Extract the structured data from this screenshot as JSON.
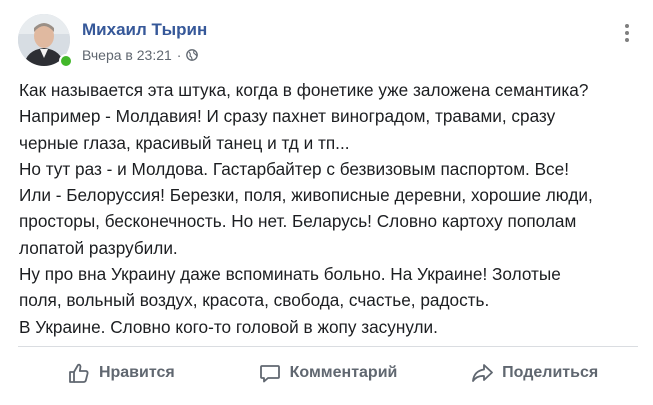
{
  "post": {
    "author": "Михаил Тырин",
    "timestamp": "Вчера в 23:21",
    "separator": "·",
    "privacy_icon": "globe-icon",
    "lines": [
      "Как называется эта штука, когда в фонетике уже заложена семантика?",
      "Например - Молдавия! И сразу пахнет виноградом, травами, сразу",
      "черные глаза, красивый танец и тд и тп...",
      "Но тут раз - и Молдова. Гастарбайтер с безвизовым паспортом. Все!",
      "Или - Белоруссия! Березки, поля, живописные деревни, хорошие люди,",
      "просторы, бесконечность. Но нет. Беларусь! Словно картоху пополам",
      "лопатой разрубили.",
      "Ну про вна Украину даже вспоминать больно. На Украине! Золотые",
      "поля, вольный воздух, красота, свобода, счастье, радость.",
      "В Украине. Словно кого-то головой в жопу засунули."
    ]
  },
  "actions": {
    "like": "Нравится",
    "comment": "Комментарий",
    "share": "Поделиться"
  },
  "colors": {
    "author": "#365899",
    "meta": "#606770",
    "online": "#42b72a",
    "divider": "#dadde1"
  }
}
